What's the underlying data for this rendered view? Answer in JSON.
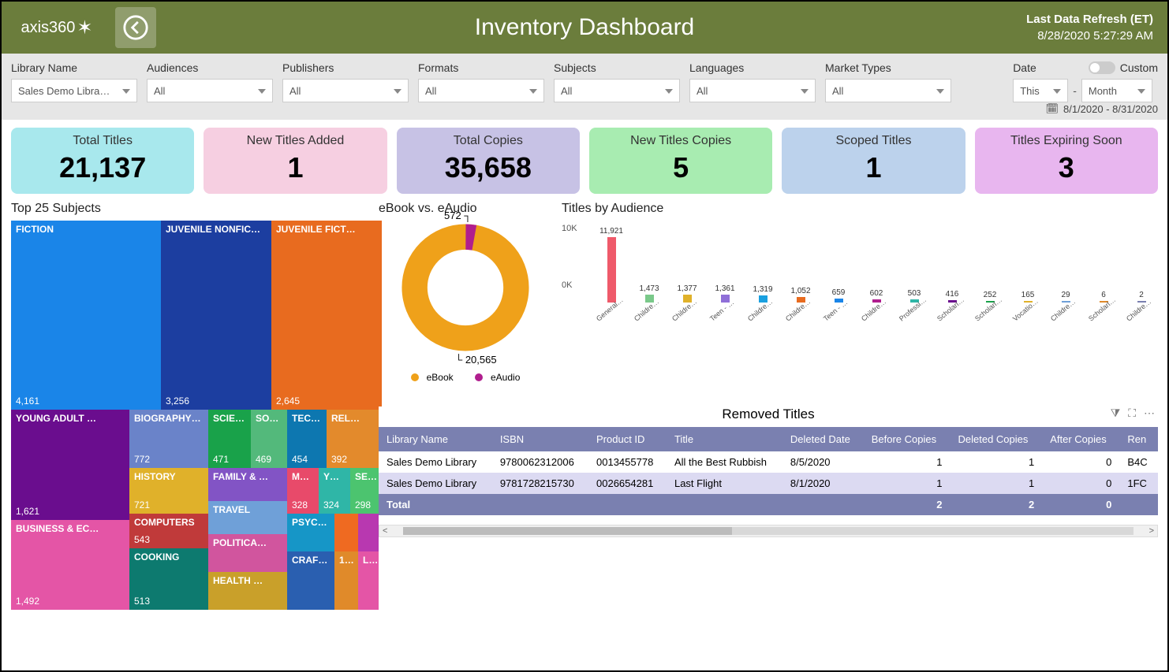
{
  "brand": "axis360",
  "header": {
    "title": "Inventory Dashboard",
    "refresh_label": "Last Data Refresh (ET)",
    "refresh_time": "8/28/2020 5:27:29 AM"
  },
  "filters": {
    "library_name": {
      "label": "Library Name",
      "value": "Sales Demo Libra…"
    },
    "audiences": {
      "label": "Audiences",
      "value": "All"
    },
    "publishers": {
      "label": "Publishers",
      "value": "All"
    },
    "formats": {
      "label": "Formats",
      "value": "All"
    },
    "subjects": {
      "label": "Subjects",
      "value": "All"
    },
    "languages": {
      "label": "Languages",
      "value": "All"
    },
    "market_types": {
      "label": "Market Types",
      "value": "All"
    },
    "date": {
      "label": "Date",
      "custom_label": "Custom",
      "interval_anchor": "This",
      "interval_sep": "-",
      "interval_unit": "Month",
      "range": "8/1/2020 - 8/31/2020"
    }
  },
  "kpis": [
    {
      "label": "Total Titles",
      "value": "21,137",
      "bg": "#a8e8ed"
    },
    {
      "label": "New Titles Added",
      "value": "1",
      "bg": "#f6cfe1"
    },
    {
      "label": "Total Copies",
      "value": "35,658",
      "bg": "#c7c2e5"
    },
    {
      "label": "New Titles Copies",
      "value": "5",
      "bg": "#a8ecb1"
    },
    {
      "label": "Scoped Titles",
      "value": "1",
      "bg": "#bcd2ec"
    },
    {
      "label": "Titles Expiring Soon",
      "value": "3",
      "bg": "#e8b6ef"
    }
  ],
  "treemap": {
    "title": "Top 25 Subjects",
    "cells": [
      {
        "name": "FICTION",
        "count": "4,161",
        "color": "#1a85e8"
      },
      {
        "name": "JUVENILE NONFIC…",
        "count": "3,256",
        "color": "#1c3ea0"
      },
      {
        "name": "JUVENILE FICT…",
        "count": "2,645",
        "color": "#e86b1f"
      },
      {
        "name": "YOUNG ADULT …",
        "count": "1,621",
        "color": "#6a0d8e"
      },
      {
        "name": "BIOGRAPHY…",
        "count": "772",
        "color": "#6a83c9"
      },
      {
        "name": "SCIE…",
        "count": "471",
        "color": "#19a24a"
      },
      {
        "name": "SOCI…",
        "count": "469",
        "color": "#53b97b"
      },
      {
        "name": "TEC…",
        "count": "454",
        "color": "#0d77b0"
      },
      {
        "name": "REL…",
        "count": "392",
        "color": "#e38a2c"
      },
      {
        "name": "HISTORY",
        "count": "721",
        "color": "#e0b12a"
      },
      {
        "name": "FAMILY & …",
        "count": "",
        "color": "#8254c5"
      },
      {
        "name": "ME…",
        "count": "328",
        "color": "#e84a6a"
      },
      {
        "name": "YO…",
        "count": "324",
        "color": "#2fb6a7"
      },
      {
        "name": "SE…",
        "count": "298",
        "color": "#4cc46f"
      },
      {
        "name": "BUSINESS & EC…",
        "count": "1,492",
        "color": "#e455a6"
      },
      {
        "name": "COMPUTERS",
        "count": "543",
        "color": "#c03a3a"
      },
      {
        "name": "TRAVEL",
        "count": "",
        "color": "#6fa0d8"
      },
      {
        "name": "PSYC…",
        "count": "",
        "color": "#1696c7"
      },
      {
        "name": " ",
        "count": "",
        "color": "#ef6a21"
      },
      {
        "name": " ",
        "count": "",
        "color": "#b838b0"
      },
      {
        "name": "COOKING",
        "count": "513",
        "color": "#0d7a6f"
      },
      {
        "name": "POLITICA…",
        "count": "",
        "color": "#d1559e"
      },
      {
        "name": "HEALTH …",
        "count": "",
        "color": "#c9a02a"
      },
      {
        "name": "CRAF…",
        "count": "",
        "color": "#2a5fb0"
      },
      {
        "name": "1…",
        "count": "",
        "color": "#e08a2a"
      },
      {
        "name": "LANG…",
        "count": "",
        "color": "#e455a6"
      }
    ]
  },
  "chart_data": [
    {
      "type": "pie",
      "title": "eBook vs. eAudio",
      "series": [
        {
          "name": "eBook",
          "value": 20565,
          "label": "20,565",
          "color": "#efa11a"
        },
        {
          "name": "eAudio",
          "value": 572,
          "label": "572",
          "color": "#b01e8e"
        }
      ],
      "legend": [
        "eBook",
        "eAudio"
      ]
    },
    {
      "type": "bar",
      "title": "Titles by Audience",
      "ylabel": "",
      "y_ticks": [
        "0K",
        "10K"
      ],
      "ylim": [
        0,
        12000
      ],
      "categories": [
        "General Adult",
        "Children's - Grade 4-6, …",
        "Children's - Grade 3-4, A…",
        "Teen - Grade 7-9, Age 12…",
        "Children's - Kindergarte…",
        "Children's - Grade 1-2, A…",
        "Teen - Grade 10-12, Age …",
        "Children's - Grade 2-3, A…",
        "Professional",
        "Scholarly/Undergraduate",
        "Scholarly/Graduate",
        "Vocational/Technical",
        "Children's - Toddlers, Ag…",
        "Scholarly/Associate",
        "Children's - Babies, Age …"
      ],
      "values": [
        11921,
        1473,
        1377,
        1361,
        1319,
        1052,
        659,
        602,
        503,
        416,
        252,
        165,
        29,
        6,
        2
      ],
      "colors": [
        "#ef5a6a",
        "#7ac98a",
        "#e0b12a",
        "#8f6fd8",
        "#1aa0e0",
        "#e86b1f",
        "#1a85e8",
        "#b01e8e",
        "#2fb6a7",
        "#6a0d8e",
        "#19a24a",
        "#e0b12a",
        "#6fa0d8",
        "#e08a2a",
        "#7a80b0"
      ]
    }
  ],
  "removed_titles": {
    "title": "Removed Titles",
    "columns": [
      "Library Name",
      "ISBN",
      "Product ID",
      "Title",
      "Deleted Date",
      "Before Copies",
      "Deleted Copies",
      "After Copies",
      "Ren"
    ],
    "rows": [
      [
        "Sales Demo Library",
        "9780062312006",
        "0013455778",
        "All the Best Rubbish",
        "8/5/2020",
        "1",
        "1",
        "0",
        "B4C"
      ],
      [
        "Sales Demo Library",
        "9781728215730",
        "0026654281",
        "Last Flight",
        "8/1/2020",
        "1",
        "1",
        "0",
        "1FC"
      ]
    ],
    "footer": [
      "Total",
      "",
      "",
      "",
      "",
      "2",
      "2",
      "0",
      ""
    ]
  }
}
